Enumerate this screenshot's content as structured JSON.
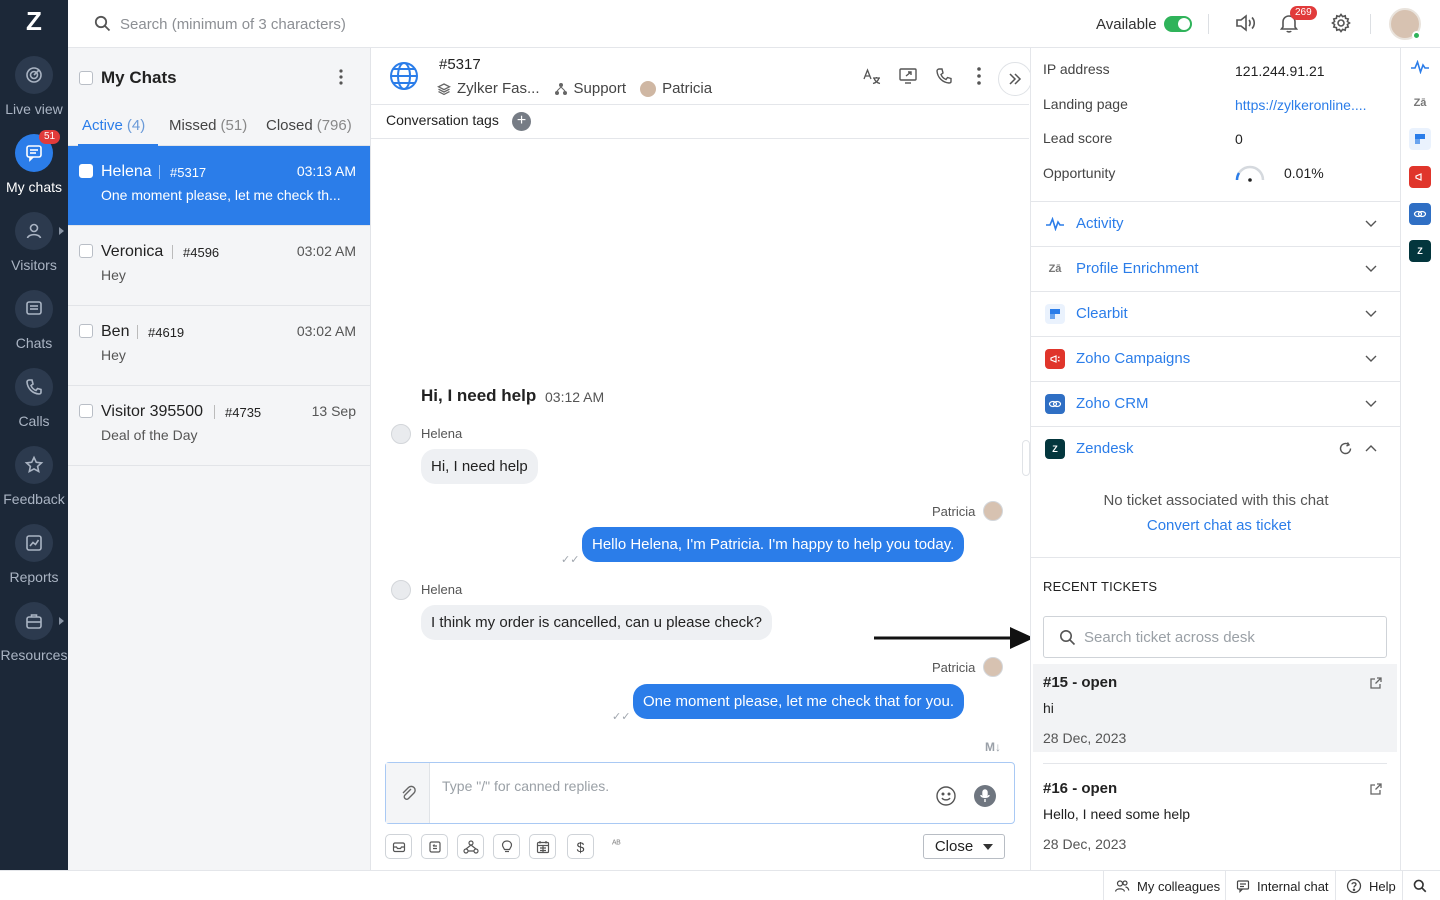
{
  "nav": {
    "logo": "Z",
    "items": [
      {
        "label": "Live view",
        "icon": "radar-icon"
      },
      {
        "label": "My chats",
        "icon": "chat-bubble-icon",
        "badge": "51"
      },
      {
        "label": "Visitors",
        "icon": "person-icon"
      },
      {
        "label": "Chats",
        "icon": "chats-icon"
      },
      {
        "label": "Calls",
        "icon": "phone-icon"
      },
      {
        "label": "Feedback",
        "icon": "star-icon"
      },
      {
        "label": "Reports",
        "icon": "chart-icon"
      },
      {
        "label": "Resources",
        "icon": "briefcase-icon"
      }
    ]
  },
  "topbar": {
    "search_placeholder": "Search (minimum of 3 characters)",
    "status_label": "Available",
    "notification_count": "269"
  },
  "chatlist": {
    "title": "My Chats",
    "tabs": [
      {
        "label": "Active",
        "count": "(4)"
      },
      {
        "label": "Missed",
        "count": "(51)"
      },
      {
        "label": "Closed",
        "count": "(796)"
      }
    ],
    "items": [
      {
        "name": "Helena",
        "id": "#5317",
        "time": "03:13 AM",
        "message": "One moment please, let me check th..."
      },
      {
        "name": "Veronica",
        "id": "#4596",
        "time": "03:02 AM",
        "message": "Hey"
      },
      {
        "name": "Ben",
        "id": "#4619",
        "time": "03:02 AM",
        "message": "Hey"
      },
      {
        "name": "Visitor 395500",
        "id": "#4735",
        "time": "13 Sep",
        "message": "Deal of the Day"
      }
    ]
  },
  "conversation": {
    "id": "#5317",
    "company": "Zylker Fas...",
    "department": "Support",
    "agent": "Patricia",
    "tags_label": "Conversation tags",
    "title": "Hi, I need help",
    "title_time": "03:12 AM",
    "messages": [
      {
        "sender": "Helena",
        "text": "Hi, I need help"
      },
      {
        "sender": "Patricia",
        "text": "Hello Helena, I'm Patricia. I'm happy to help you today."
      },
      {
        "sender": "Helena",
        "text": "I think my order is cancelled, can u please check?"
      },
      {
        "sender": "Patricia",
        "text": "One moment please, let me check that for you."
      }
    ],
    "composer_placeholder": "Type \"/\" for canned replies.",
    "close_label": "Close"
  },
  "panel": {
    "info": [
      {
        "label": "IP address",
        "value": "121.244.91.21"
      },
      {
        "label": "Landing page",
        "value": "https://zylkeronline...."
      },
      {
        "label": "Lead score",
        "value": "0"
      },
      {
        "label": "Opportunity",
        "value": "0.01%"
      }
    ],
    "sections": [
      {
        "label": "Activity",
        "icon": "activity-icon"
      },
      {
        "label": "Profile Enrichment",
        "icon": "profile-enrichment-icon"
      },
      {
        "label": "Clearbit",
        "icon": "clearbit-icon"
      },
      {
        "label": "Zoho Campaigns",
        "icon": "campaigns-icon"
      },
      {
        "label": "Zoho CRM",
        "icon": "crm-icon"
      },
      {
        "label": "Zendesk",
        "icon": "zendesk-icon"
      }
    ],
    "zendesk_empty": "No ticket associated with this chat",
    "zendesk_convert": "Convert chat as ticket",
    "recent_label": "RECENT TICKETS",
    "ticket_search_placeholder": "Search ticket across desk",
    "tickets": [
      {
        "title": "#15 - open",
        "body": "hi",
        "date": "28 Dec, 2023"
      },
      {
        "title": "#16 - open",
        "body": "Hello, I need some help",
        "date": "28 Dec, 2023"
      }
    ]
  },
  "bottombar": {
    "colleagues": "My colleagues",
    "internal_chat": "Internal chat",
    "help": "Help"
  },
  "colors": {
    "accent": "#2b7de9",
    "sidebar_bg": "#1c2838",
    "available": "#2fb35a",
    "badge": "#e13b3b"
  }
}
